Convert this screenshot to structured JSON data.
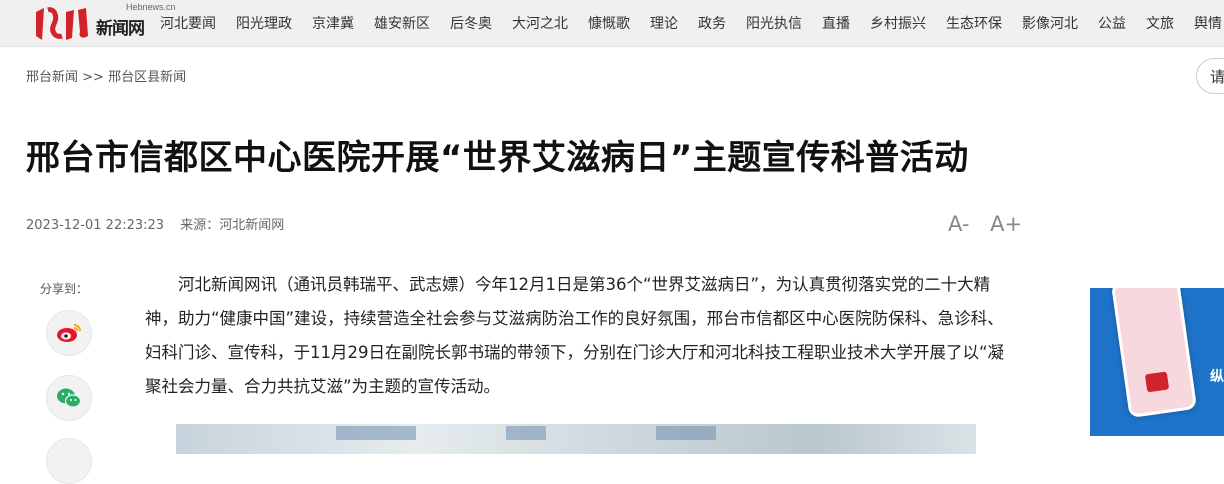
{
  "logo": {
    "url_text": "Hebnews.cn",
    "site_name": "新闻网"
  },
  "nav": {
    "items": [
      "河北要闻",
      "阳光理政",
      "京津冀",
      "雄安新区",
      "后冬奥",
      "大河之北",
      "慷慨歌",
      "理论",
      "政务",
      "阳光执信",
      "直播",
      "乡村振兴",
      "生态环保",
      "影像河北",
      "公益",
      "文旅",
      "舆情"
    ]
  },
  "breadcrumb": {
    "home": "邢台新闻",
    "separator": ">>",
    "section": "邢台区县新闻"
  },
  "search": {
    "label": "请"
  },
  "article": {
    "title": "邢台市信都区中心医院开展“世界艾滋病日”主题宣传科普活动",
    "datetime": "2023-12-01 22:23:23",
    "source": "来源：河北新闻网",
    "font_decrease": "A-",
    "font_increase": "A+",
    "body": "河北新闻网讯（通讯员韩瑞平、武志嫖）今年12月1日是第36个“世界艾滋病日”，为认真贯彻落实党的二十大精神，助力“健康中国”建设，持续营造全社会参与艾滋病防治工作的良好氛围，邢台市信都区中心医院防保科、急诊科、妇科门诊、宣传科，于11月29日在副院长郭书瑞的带领下，分别在门诊大厅和河北科技工程职业技术大学开展了以“凝聚社会力量、合力共抗艾滋”为主题的宣传活动。"
  },
  "share": {
    "label": "分享到：",
    "buttons": [
      "weibo-icon",
      "wechat-icon"
    ]
  },
  "promo": {
    "char": "纵"
  },
  "colors": {
    "weibo": "#e6162d",
    "wechat": "#2aae67",
    "promo_bg": "#1e73c8"
  }
}
